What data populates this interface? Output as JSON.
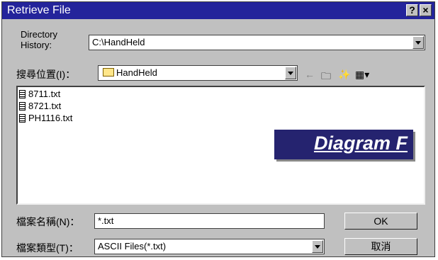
{
  "window": {
    "title": "Retrieve File",
    "help_label": "?",
    "close_label": "×"
  },
  "directory_history": {
    "label": "Directory History:",
    "value": "C:\\HandHeld"
  },
  "look_in": {
    "label": "搜尋位置(I)：",
    "value": "HandHeld"
  },
  "toolbar": {
    "back_icon": "back-arrow-icon",
    "up_icon": "up-folder-icon",
    "new_icon": "new-folder-icon",
    "view_icon": "view-menu-icon"
  },
  "files": [
    {
      "name": "8711.txt"
    },
    {
      "name": "8721.txt"
    },
    {
      "name": "PH1116.txt"
    }
  ],
  "overlay": {
    "label": "Diagram F",
    "color": "#25236f"
  },
  "file_name": {
    "label": "檔案名稱(N)：",
    "value": "*.txt"
  },
  "file_type": {
    "label": "檔案類型(T)：",
    "value": "ASCII Files(*.txt)"
  },
  "buttons": {
    "ok": "OK",
    "cancel": "取消"
  }
}
